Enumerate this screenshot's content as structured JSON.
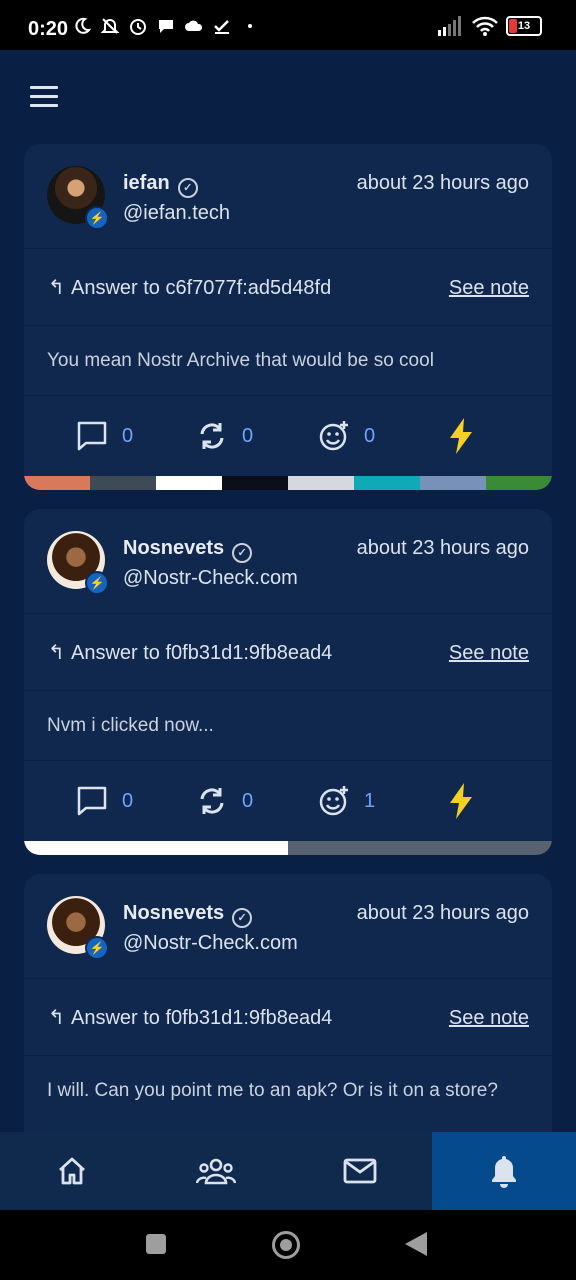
{
  "status_bar": {
    "time": "0:20",
    "battery": "13",
    "icons": [
      "moon-icon",
      "no-disturb-icon",
      "alarm-icon",
      "chat-icon",
      "cloud-icon",
      "check-icon",
      "dot-icon",
      "signal-icon",
      "wifi-icon",
      "battery-icon"
    ]
  },
  "notes": [
    {
      "name": "iefan",
      "handle": "@iefan.tech",
      "time_ago": "about 23 hours ago",
      "answer_to": "Answer to c6f7077f:ad5d48fd",
      "see_note": "See note",
      "content": "You mean Nostr Archive that would be so cool",
      "replies": "0",
      "reposts": "0",
      "reactions": "0",
      "color_bar": [
        "#d9795c",
        "#3f4a57",
        "#ffffff",
        "#0a0f1a",
        "#d5d8de",
        "#10a9b8",
        "#7891b8",
        "#3b8a35"
      ]
    },
    {
      "name": "Nosnevets",
      "handle": "@Nostr-Check.com",
      "time_ago": "about 23 hours ago",
      "answer_to": "Answer to f0fb31d1:9fb8ead4",
      "see_note": "See note",
      "content": "Nvm i clicked now...",
      "replies": "0",
      "reposts": "0",
      "reactions": "1",
      "color_bar": [
        "#ffffff",
        "#596270"
      ]
    },
    {
      "name": "Nosnevets",
      "handle": "@Nostr-Check.com",
      "time_ago": "about 23 hours ago",
      "answer_to": "Answer to f0fb31d1:9fb8ead4",
      "see_note": "See note",
      "content": "I will. Can you point me to an apk? Or is it on a store?"
    }
  ],
  "bottom_nav": {
    "items": [
      "home-icon",
      "community-icon",
      "mail-icon",
      "bell-icon"
    ],
    "active": "bell-icon"
  },
  "colors": {
    "background": "#0a1f44",
    "card": "#10284e",
    "accent": "#6fa3ff",
    "zap": "#f5d020",
    "active_nav": "#064a8e"
  }
}
